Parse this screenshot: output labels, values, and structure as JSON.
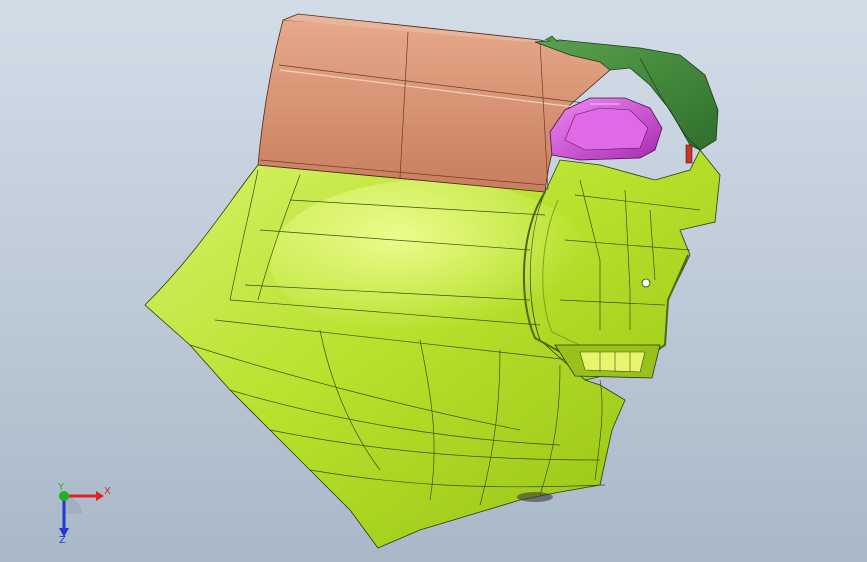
{
  "viewport": {
    "background_top": "#d3dde8",
    "background_bottom": "#a9b8c8"
  },
  "model": {
    "parts": [
      {
        "name": "lower-panel",
        "color": "#b7e22e"
      },
      {
        "name": "upper-panel",
        "color": "#d99474"
      },
      {
        "name": "side-trim",
        "color": "#3f8a3a"
      },
      {
        "name": "lamp-cover",
        "color": "#d23fd8"
      },
      {
        "name": "marker-tab",
        "color": "#c8332a"
      }
    ]
  },
  "triad": {
    "x_label": "X",
    "y_label": "Y",
    "z_label": "Z",
    "x_color": "#e02424",
    "y_color": "#23b023",
    "z_color": "#2436d8"
  }
}
